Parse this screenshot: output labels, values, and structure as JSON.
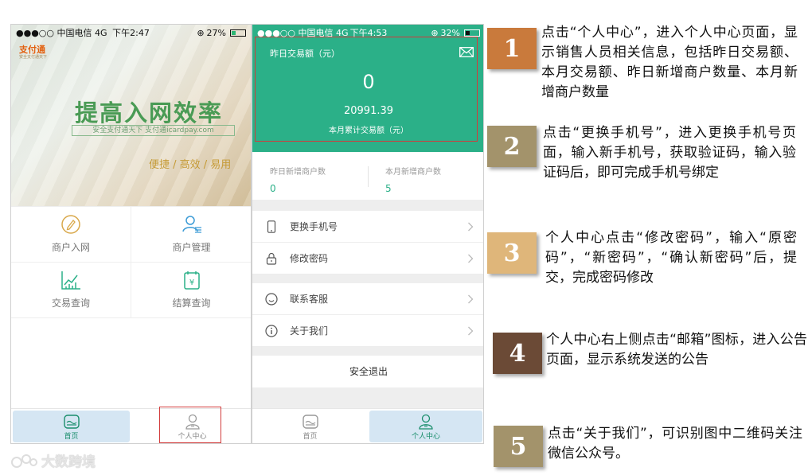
{
  "phone1": {
    "status": {
      "signal": "●●●○○",
      "carrier": "中国电信",
      "network": "4G",
      "time": "下午2:47",
      "battery": "27%"
    },
    "banner": {
      "logo": "支付通",
      "logo_sub": "安全支付通天下",
      "slogan": "提高入网效率",
      "slogan_sub": "安全支付通天下  支付通icardpay.com",
      "tagline": "便捷 / 高效 / 易用"
    },
    "grid": [
      {
        "label": "商户入网",
        "icon": "pencil-circle-icon"
      },
      {
        "label": "商户管理",
        "icon": "user-list-icon"
      },
      {
        "label": "交易查询",
        "icon": "line-chart-icon"
      },
      {
        "label": "结算查询",
        "icon": "yen-calendar-icon"
      }
    ],
    "tabs": [
      {
        "label": "首页",
        "icon": "home-icon"
      },
      {
        "label": "个人中心",
        "icon": "person-icon"
      }
    ]
  },
  "phone2": {
    "status": {
      "signal": "●●●○○",
      "carrier": "中国电信",
      "network": "4G",
      "time": "下午4:53",
      "battery": "32%"
    },
    "header": {
      "yesterday_label": "昨日交易额（元）",
      "yesterday_value": "0",
      "month_value": "20991.39",
      "month_label": "本月累计交易额（元）"
    },
    "merchants": [
      {
        "label": "昨日新增商户数",
        "value": "0"
      },
      {
        "label": "本月新增商户数",
        "value": "5"
      }
    ],
    "menu1": [
      {
        "label": "更换手机号",
        "icon": "phone-icon"
      },
      {
        "label": "修改密码",
        "icon": "lock-icon"
      }
    ],
    "menu2": [
      {
        "label": "联系客服",
        "icon": "smile-icon"
      },
      {
        "label": "关于我们",
        "icon": "info-icon"
      }
    ],
    "logout": "安全退出",
    "tabs": [
      {
        "label": "首页",
        "icon": "home-icon"
      },
      {
        "label": "个人中心",
        "icon": "person-icon"
      }
    ]
  },
  "steps": [
    {
      "num": "1",
      "color": "#c97a3c",
      "text": "点击“个人中心”，进入个人中心页面，显示销售人员相关信息，包括昨日交易额、本月交易额、昨日新增商户数量、本月新增商户数量"
    },
    {
      "num": "2",
      "color": "#a3936b",
      "text": "点击“更换手机号”，进入更换手机号页面，输入新手机号，获取验证码，输入验证码后，即可完成手机号绑定"
    },
    {
      "num": "3",
      "color": "#dfb67a",
      "text": "个人中心点击“修改密码”，输入“原密码”，“新密码”，“确认新密码”后，提交，完成密码修改"
    },
    {
      "num": "4",
      "color": "#6b4a36",
      "text": "个人中心右上侧点击“邮箱”图标，进入公告页面，显示系统发送的公告"
    },
    {
      "num": "5",
      "color": "#a3936b",
      "text": "点击“关于我们”，可识别图中二维码关注微信公众号。"
    }
  ],
  "watermark": "大数跨境"
}
